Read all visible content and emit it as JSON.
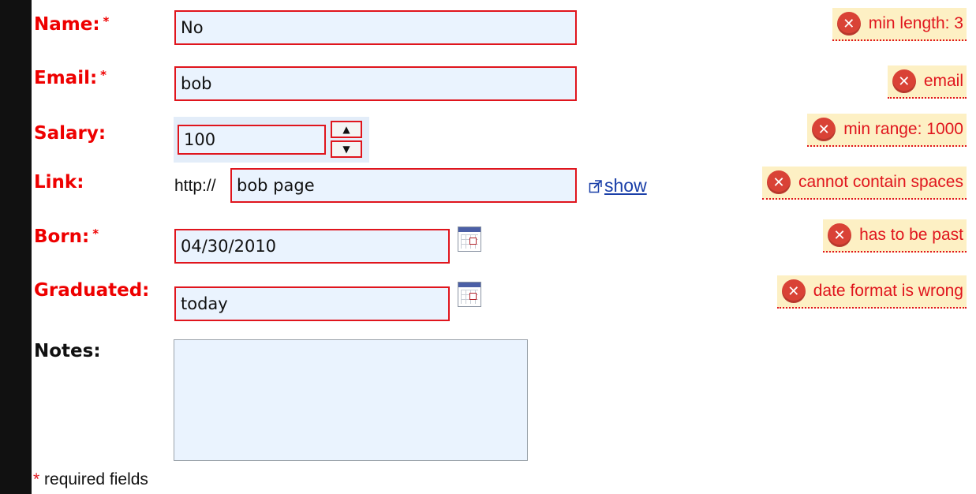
{
  "form": {
    "name": {
      "label": "Name:",
      "required_mark": "*",
      "value": "No",
      "error": "min length: 3"
    },
    "email": {
      "label": "Email:",
      "required_mark": "*",
      "value": "bob",
      "error": "email"
    },
    "salary": {
      "label": "Salary:",
      "value": "100",
      "error": "min range: 1000",
      "up_glyph": "▲",
      "down_glyph": "▼"
    },
    "link": {
      "label": "Link:",
      "prefix": "http://",
      "value": "bob page",
      "show_label": "show",
      "error": "cannot contain spaces"
    },
    "born": {
      "label": "Born:",
      "required_mark": "*",
      "value": "04/30/2010",
      "error": "has to be past"
    },
    "graduated": {
      "label": "Graduated:",
      "value": "today",
      "error": "date format is wrong"
    },
    "notes": {
      "label": "Notes:",
      "value": ""
    }
  },
  "footnote": {
    "mark": "*",
    "text": " required fields"
  },
  "icons": {
    "error": "error-circle-x-icon",
    "calendar": "calendar-icon",
    "external_link": "external-link-icon"
  },
  "colors": {
    "error_red": "#e0151d",
    "field_bg": "#eaf3fe",
    "error_bg": "#fdf0c4",
    "link_blue": "#1a3fa8"
  }
}
